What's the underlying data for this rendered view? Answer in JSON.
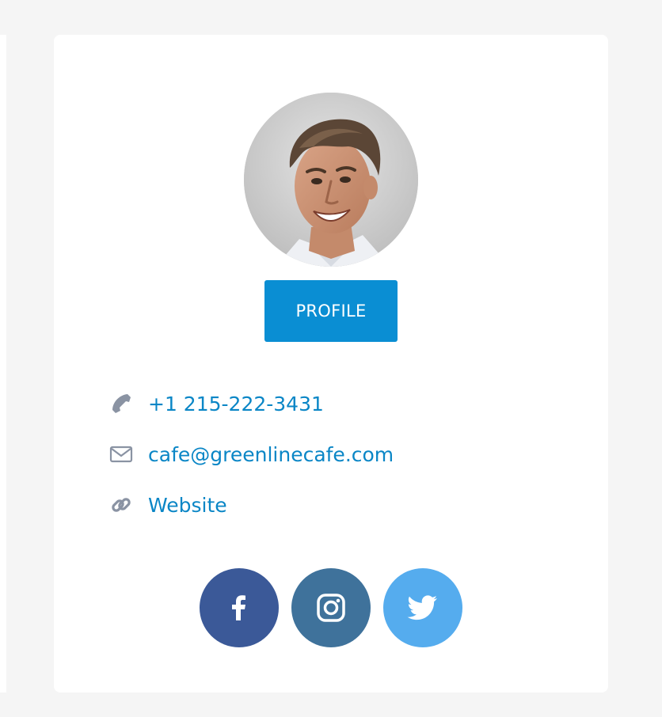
{
  "profile": {
    "button_label": "PROFILE"
  },
  "contact": {
    "phone": "+1 215-222-3431",
    "email": "cafe@greenlinecafe.com",
    "website": "Website"
  },
  "icons": {
    "phone": "phone-icon",
    "email": "envelope-icon",
    "website": "link-icon",
    "facebook": "facebook-icon",
    "instagram": "instagram-icon",
    "twitter": "twitter-icon"
  },
  "colors": {
    "accent": "#0a8ed3",
    "link": "#0a86c6",
    "icon_gray": "#8a93a3",
    "facebook": "#3b5998",
    "instagram": "#3f729b",
    "twitter": "#55acee"
  }
}
